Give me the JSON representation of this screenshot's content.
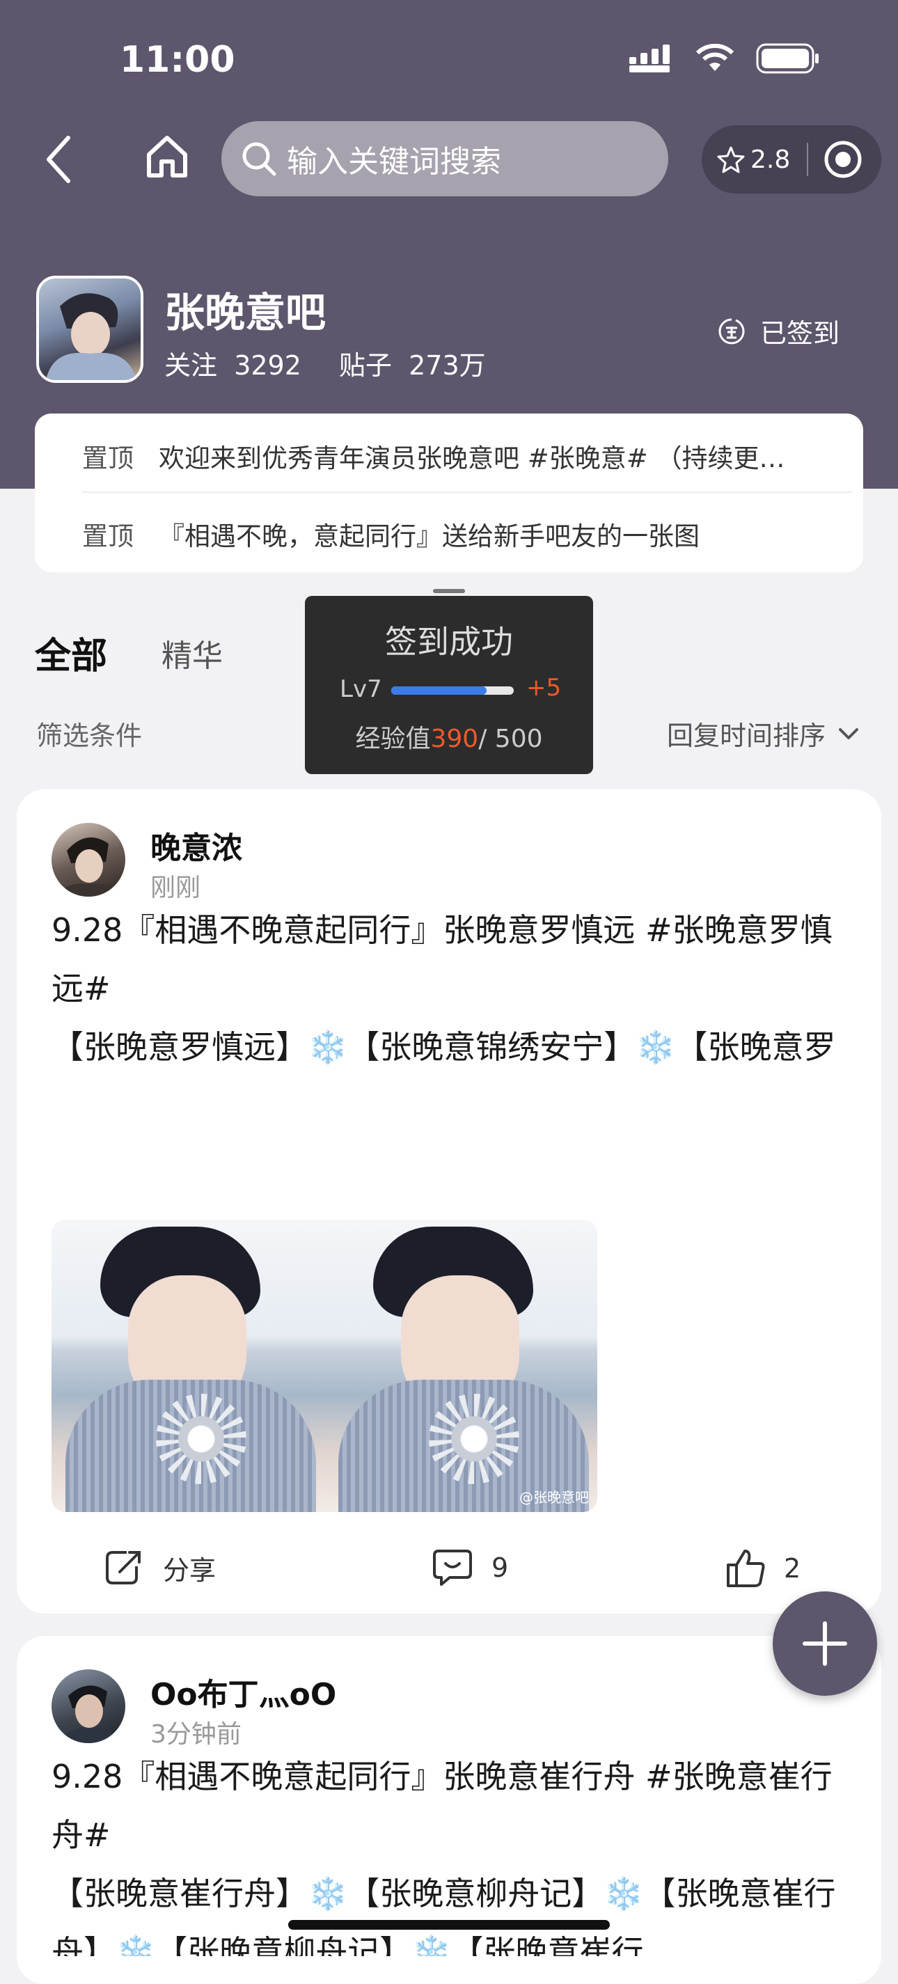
{
  "status_bar": {
    "time": "11:00"
  },
  "nav": {
    "search_placeholder": "输入关键词搜索",
    "rating": "2.8"
  },
  "forum": {
    "name": "张晚意吧",
    "follow_label": "关注",
    "follow_count": "3292",
    "posts_label": "贴子",
    "posts_count": "273万",
    "checkin_label": "已签到"
  },
  "pinned": [
    {
      "tag": "置顶",
      "text": "欢迎来到优秀青年演员张晚意吧 #张晚意# （持续更…"
    },
    {
      "tag": "置顶",
      "text": "『相遇不晚，意起同行』送给新手吧友的一张图"
    }
  ],
  "tabs": {
    "all": "全部",
    "best": "精华"
  },
  "filter_label": "筛选条件",
  "sort_label": "回复时间排序",
  "toast": {
    "title": "签到成功",
    "level": "Lv7",
    "level_progress": 0.78,
    "plus": "+5",
    "exp_label": "经验值",
    "exp_current": "390",
    "exp_total": "/ 500"
  },
  "posts": [
    {
      "author": "晚意浓",
      "time": "刚刚",
      "lines": [
        "9.28『相遇不晚意起同行』张晚意罗慎远 #张晚意罗慎远#",
        "【张晚意罗慎远】❄️【张晚意锦绣安宁】❄️【张晚意罗慎远】❄️【张晚意锦绣安宁】❄️【张晚意罗慎远】❄️【张晚意锦绣安宁】❄️#张晚意罗慎…"
      ],
      "watermark": "@张晚意吧",
      "share_label": "分享",
      "comments": "9",
      "likes": "2"
    },
    {
      "author": "Oo布丁灬oO",
      "time": "3分钟前",
      "lines": [
        "9.28『相遇不晚意起同行』张晚意崔行舟 #张晚意崔行舟#",
        "【张晚意崔行舟】❄️【张晚意柳舟记】❄️【张晚意崔行舟】❄️【张晚意柳舟记】❄️【张晚意崔行"
      ]
    }
  ],
  "colors": {
    "header": "#5e566c",
    "accent": "#ee5a2a",
    "progress": "#3d7ce8"
  }
}
